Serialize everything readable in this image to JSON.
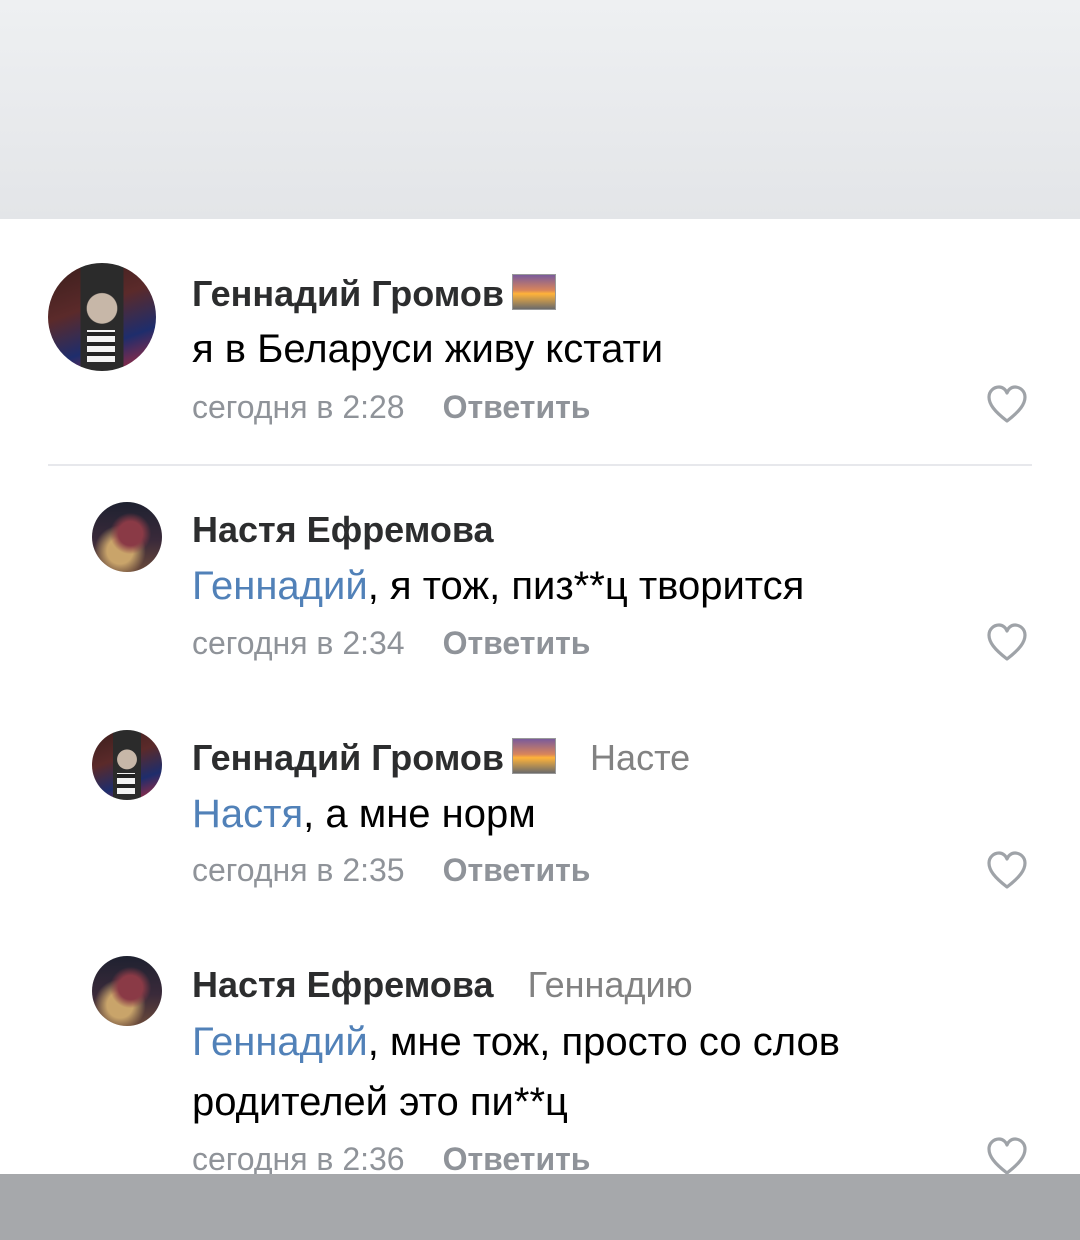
{
  "comments": [
    {
      "author": "Геннадий Громов",
      "reply_to": "",
      "mention": "",
      "text": "я в Беларуси живу кстати",
      "text2": "",
      "time": "сегодня в 2:28",
      "reply_label": "Ответить"
    },
    {
      "author": "Настя Ефремова",
      "reply_to": "",
      "mention": "Геннадий",
      "text": ", я тож, пиз**ц творится",
      "text2": "",
      "time": "сегодня в 2:34",
      "reply_label": "Ответить"
    },
    {
      "author": "Геннадий Громов",
      "reply_to": "Насте",
      "mention": "Настя",
      "text": ", а мне норм",
      "text2": "",
      "time": "сегодня в 2:35",
      "reply_label": "Ответить"
    },
    {
      "author": "Настя Ефремова",
      "reply_to": "Геннадию",
      "mention": "Геннадий",
      "text": ", мне тож, просто со слов",
      "text2": "родителей это пи**ц",
      "time": "сегодня в 2:36",
      "reply_label": "Ответить"
    }
  ],
  "icons": {
    "like": "heart-outline-icon",
    "badge": "sunset-flag-icon"
  },
  "colors": {
    "mention": "#5181b8",
    "meta": "#8f9399",
    "bottom_bar": "#a6a8ab"
  }
}
